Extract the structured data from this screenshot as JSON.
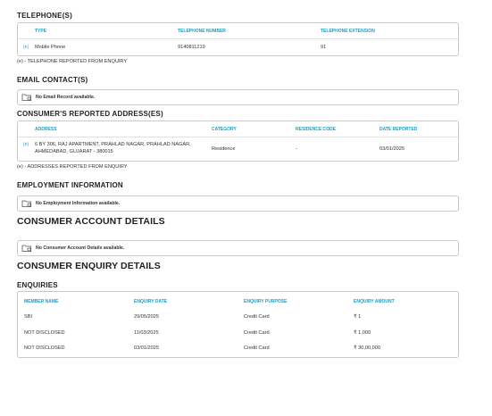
{
  "telephones": {
    "title": "TELEPHONE(S)",
    "headers": [
      "TYPE",
      "TELEPHONE NUMBER",
      "TELEPHONE EXTENSION"
    ],
    "rows": [
      {
        "badge": "(e)",
        "type": "Mobile Phone",
        "number": "9140811219",
        "extension": "91"
      }
    ],
    "note": "(e) - TELEPHONE REPORTED FROM ENQUIRY"
  },
  "email": {
    "title": "EMAIL CONTACT(S)",
    "empty": "No Email Record available."
  },
  "addresses": {
    "title": "CONSUMER'S REPORTED ADDRESS(ES)",
    "headers": [
      "ADDRESS",
      "CATEGORY",
      "RESIDENCE CODE",
      "DATE REPORTED"
    ],
    "rows": [
      {
        "badge": "(e)",
        "address": "6 BY 306, RAJ APARTMENT, PRAHLAD NAGAR, PRAHLAD NAGAR, AHMEDABAD, GUJARAT - 380015",
        "category": "Residence",
        "residence_code": "-",
        "date": "03/01/2025"
      }
    ],
    "note": "(e) - ADDRESSES REPORTED FROM ENQUIRY"
  },
  "employment": {
    "title": "EMPLOYMENT INFORMATION",
    "empty": "No Employment Information available."
  },
  "accounts": {
    "title": "CONSUMER ACCOUNT DETAILS",
    "empty": "No Consumer Account Details available."
  },
  "enquiry": {
    "title": "CONSUMER ENQUIRY DETAILS",
    "subtitle": "ENQUIRIES",
    "headers": [
      "MEMBER NAME",
      "ENQUIRY DATE",
      "ENQUIRY PURPOSE",
      "ENQUIRY AMOUNT"
    ],
    "rows": [
      {
        "member": "SBI",
        "date": "29/05/2025",
        "purpose": "Credit Card",
        "amount": "₹ 1"
      },
      {
        "member": "NOT DISCLOSED",
        "date": "11/03/2025",
        "purpose": "Credit Card",
        "amount": "₹ 1,000"
      },
      {
        "member": "NOT DISCLOSED",
        "date": "03/01/2025",
        "purpose": "Credit Card",
        "amount": "₹ 30,00,000"
      }
    ]
  },
  "colors": {
    "accent": "#1a9fc4",
    "border": "#c9c9c9",
    "text": "#2b2b2b"
  },
  "icons": {
    "empty_state": "folder-search-icon"
  }
}
